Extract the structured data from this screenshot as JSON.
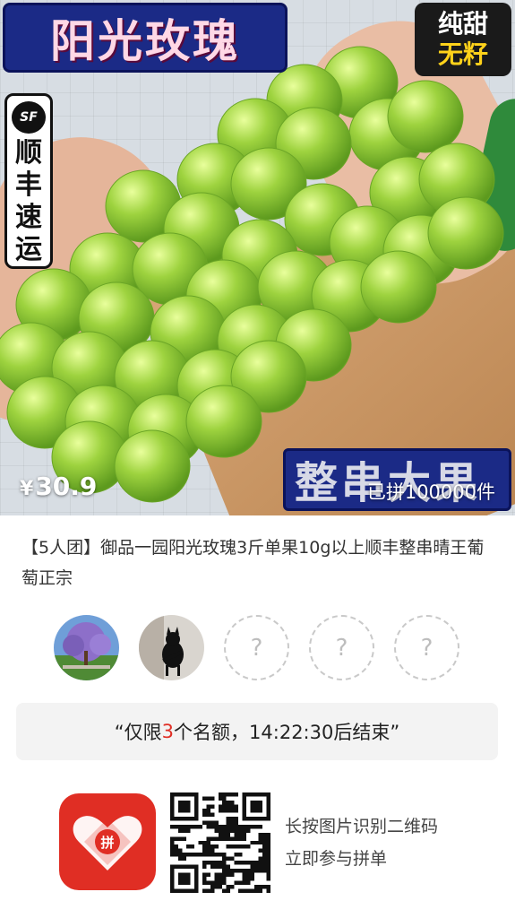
{
  "hero": {
    "title_banner": "阳光玫瑰",
    "badge_line1": "纯甜",
    "badge_line2": "无籽",
    "sf_logo": "SF",
    "sf_chars": [
      "顺",
      "丰",
      "速",
      "运"
    ],
    "big_fruit_text": "整串大果",
    "price_symbol": "¥",
    "price_value": "30.9",
    "joined_count": "已拼100000件"
  },
  "product": {
    "title": "【5人团】御品一园阳光玫瑰3斤单果10g以上顺丰整串晴王葡萄正宗"
  },
  "group": {
    "empty_slot_label": "?"
  },
  "notice": {
    "prefix": "“仅限",
    "count": "3",
    "suffix": "个名额，14:22:30后结束”"
  },
  "footer": {
    "scan_line1": "长按图片识别二维码",
    "scan_line2": "立即参与拼单"
  },
  "colors": {
    "accent": "#e02e24",
    "banner_blue": "#1b2a86",
    "grape_green": "#9ed33f"
  }
}
